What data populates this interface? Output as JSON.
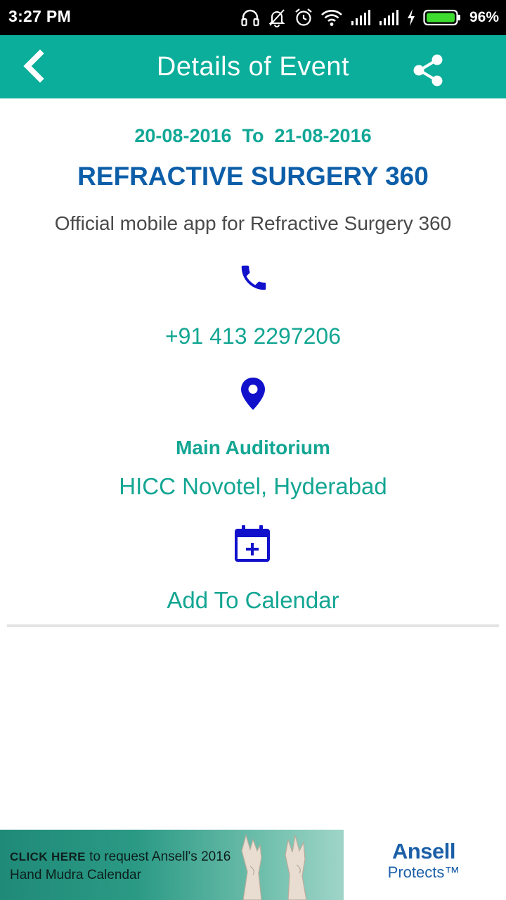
{
  "status_bar": {
    "time": "3:27 PM",
    "battery_percent": "96%",
    "icons": [
      "headphones-icon",
      "notifications-off-icon",
      "alarm-icon",
      "wifi-icon",
      "signal-icon",
      "signal-icon",
      "charging-icon",
      "battery-icon"
    ]
  },
  "app_bar": {
    "title": "Details of Event",
    "background_color": "#0aae9a",
    "back_icon": "chevron-left-icon",
    "share_icon": "share-icon"
  },
  "event": {
    "date_range": "20-08-2016  To  21-08-2016",
    "title": "REFRACTIVE SURGERY 360",
    "description": "Official mobile app for Refractive Surgery 360",
    "phone": "+91 413 2297206",
    "venue_name": "Main Auditorium",
    "venue_address": "HICC Novotel, Hyderabad",
    "add_to_calendar": "Add To Calendar",
    "accent_color": "#13a693",
    "title_color": "#0d5ea8",
    "icon_color": "#1111cc"
  },
  "ad": {
    "click_here": "CLICK HERE",
    "line1": " to request Ansell's 2016",
    "line2": "Hand Mudra Calendar",
    "brand_name": "Ansell",
    "brand_tagline": "Protects™"
  }
}
